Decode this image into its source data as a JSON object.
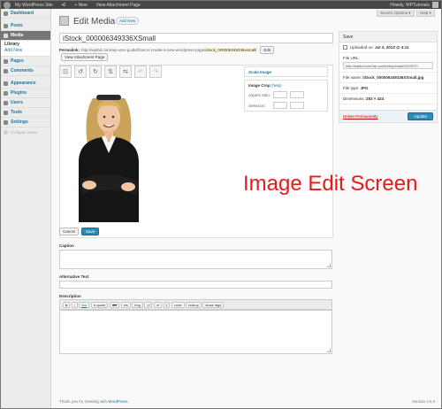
{
  "admin_bar": {
    "site_name": "My WordPress Site",
    "comments_count": "0",
    "new_label": "+ New",
    "view_attachment": "View Attachment Page",
    "howdy": "Howdy, WPTutorials"
  },
  "sidebar": {
    "items": [
      {
        "label": "Dashboard"
      },
      {
        "label": "Posts"
      },
      {
        "label": "Media"
      },
      {
        "label": "Pages"
      },
      {
        "label": "Comments"
      },
      {
        "label": "Appearance"
      },
      {
        "label": "Plugins"
      },
      {
        "label": "Users"
      },
      {
        "label": "Tools"
      },
      {
        "label": "Settings"
      }
    ],
    "media_submenu": [
      "Library",
      "Add New"
    ],
    "collapse_label": "Collapse menu"
  },
  "screen_options": {
    "screen_options_label": "Screen Options ▾",
    "help_label": "Help ▾"
  },
  "header": {
    "title": "Edit Media",
    "add_new": "Add New"
  },
  "editor": {
    "title_value": "iStock_000006349336XSmall",
    "permalink_label": "Permalink:",
    "permalink_base": "http://wptbd.com/wp-user-guide/how-to-create-a-new-wordpress-page/",
    "permalink_slug": "istock_000006349336xsmall/",
    "edit_label": "Edit",
    "view_attachment_label": "View Attachment Page",
    "tool_icons": [
      "crop-icon",
      "rotate-left-icon",
      "rotate-right-icon",
      "flip-vertical-icon",
      "flip-horizontal-icon",
      "undo-icon",
      "redo-icon"
    ],
    "scale_image": "Scale Image",
    "image_crop": "Image Crop",
    "help": "(help)",
    "aspect_ratio": "Aspect ratio:",
    "selection": "Selection:",
    "cancel": "Cancel",
    "save": "Save",
    "annotation": "Image Edit Screen"
  },
  "fields": {
    "caption": "Caption",
    "alt_text": "Alternative Text",
    "description": "Description",
    "quicktags": [
      "b",
      "i",
      "link",
      "b-quote",
      "del",
      "ins",
      "img",
      "ul",
      "ol",
      "li",
      "code",
      "lookup",
      "close tags"
    ]
  },
  "savebox": {
    "title": "Save",
    "uploaded_prefix": "Uploaded on:",
    "uploaded_value": "Jul 3, 2013 @ 4:11",
    "file_url_label": "File URL:",
    "file_url_value": "http://wptbd.com/wp-content/uploads/2013/07/",
    "file_name_label": "File name:",
    "file_name_value": "iStock_000006349336XSmall.jpg",
    "file_type_label": "File type:",
    "file_type_value": "JPG",
    "dimensions_label": "Dimensions:",
    "dimensions_value": "283 × 424",
    "delete_label": "Delete Permanently",
    "update_label": "Update"
  },
  "footer": {
    "thanks": "Thank you for creating with",
    "wp": "WordPress",
    "version": "Version 3.5.2"
  },
  "colors": {
    "accent": "#21759b",
    "annotation_red": "#e41b1b",
    "primary_button": "#2e8bb8",
    "admin_bar": "#464646"
  }
}
